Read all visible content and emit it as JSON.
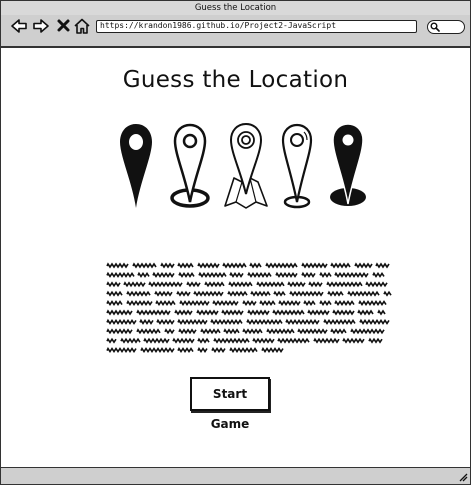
{
  "window": {
    "title": "Guess the Location"
  },
  "toolbar": {
    "url": "https://krandon1986.github.io/Project2-JavaScript",
    "icons": {
      "back": "back-arrow-icon",
      "forward": "forward-arrow-icon",
      "close": "close-icon",
      "home": "home-icon",
      "search": "search-icon"
    }
  },
  "main": {
    "heading": "Guess the Location",
    "pins": [
      "location-pin-filled-icon",
      "location-pin-ring-icon",
      "location-pin-map-icon",
      "location-pin-outline-icon",
      "location-pin-solid-icon"
    ],
    "paragraph_lines": 10,
    "start_button_label": "Start Game"
  }
}
